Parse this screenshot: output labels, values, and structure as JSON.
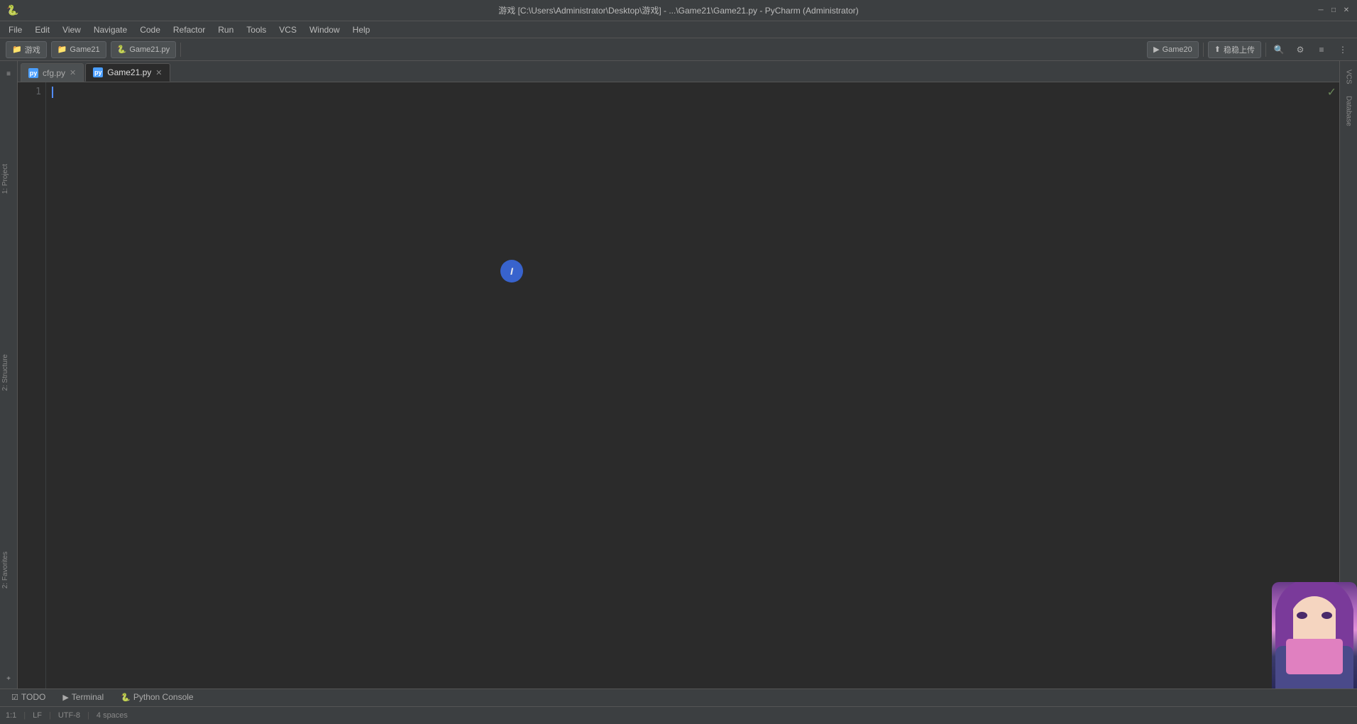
{
  "window": {
    "title": "游戏 [C:\\Users\\Administrator\\Desktop\\游戏] - ...\\Game21\\Game21.py - PyCharm (Administrator)"
  },
  "menu": {
    "items": [
      "File",
      "Edit",
      "View",
      "Navigate",
      "Code",
      "Refactor",
      "Run",
      "Tools",
      "VCS",
      "Window",
      "Help"
    ]
  },
  "toolbar": {
    "project_label": "游戏",
    "game21_label": "Game21",
    "file_label": "Game21.py",
    "game20_label": "Game20",
    "upload_label": "稳稳上传"
  },
  "tabs": [
    {
      "id": "cfg",
      "label": "cfg.py",
      "active": false,
      "icon": "py"
    },
    {
      "id": "game21",
      "label": "Game21.py",
      "active": true,
      "icon": "py"
    }
  ],
  "editor": {
    "line_numbers": [
      "1"
    ],
    "content": ""
  },
  "left_sidebar": {
    "items": [
      {
        "id": "project",
        "label": "1: Project"
      },
      {
        "id": "structure",
        "label": "2: Structure"
      },
      {
        "id": "favorites",
        "label": "2: Favorites"
      }
    ]
  },
  "right_sidebar": {
    "items": [
      {
        "id": "database",
        "label": "Database"
      },
      {
        "id": "vcs",
        "label": "VCS"
      }
    ]
  },
  "bottom_tabs": [
    {
      "id": "todo",
      "label": "TODO",
      "icon": "☑"
    },
    {
      "id": "terminal",
      "label": "Terminal",
      "icon": "▶"
    },
    {
      "id": "python_console",
      "label": "Python Console",
      "icon": "🐍"
    }
  ],
  "status_bar": {
    "line_col": "1:1",
    "lf": "LF",
    "encoding": "UTF-8",
    "indent": "4 spaces"
  },
  "blue_cursor": {
    "symbol": "I"
  }
}
